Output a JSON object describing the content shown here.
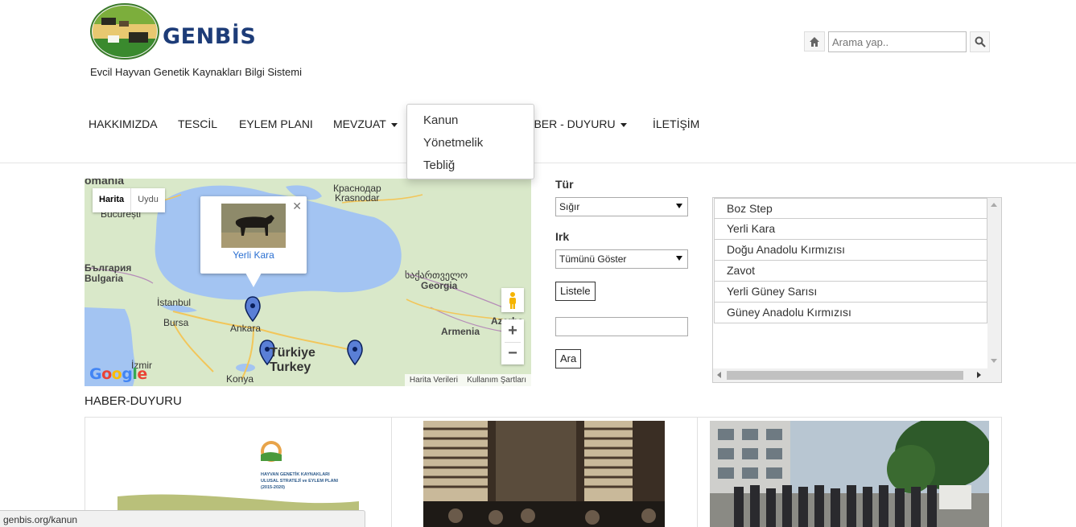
{
  "header": {
    "brand": "GENBİS",
    "tagline": "Evcil Hayvan Genetik Kaynakları Bilgi Sistemi",
    "search": {
      "placeholder": "Arama yap.."
    }
  },
  "nav": {
    "items": [
      {
        "label": "HAKKIMIZDA"
      },
      {
        "label": "TESCİL"
      },
      {
        "label": "EYLEM PLANI"
      },
      {
        "label": "MEVZUAT"
      },
      {
        "label": "HABER - DUYURU"
      },
      {
        "label": "İLETİŞİM"
      }
    ],
    "dropdown": [
      "Kanun",
      "Yönetmelik",
      "Tebliğ"
    ]
  },
  "map": {
    "type_buttons": [
      "Harita",
      "Uydu"
    ],
    "labels": {
      "romania": "omania",
      "bucharest": "București",
      "bulgaria_bg": "България",
      "bulgaria": "Bulgaria",
      "istanbul": "İstanbul",
      "bursa": "Bursa",
      "ankara": "Ankara",
      "izmir": "İzmir",
      "konya": "Konya",
      "turkiye": "Türkiye",
      "turkey": "Turkey",
      "krasnodar_ru": "Краснодар",
      "krasnodar": "Krasnodar",
      "georgia_ka": "საქართველო",
      "georgia": "Georgia",
      "armenia": "Armenia",
      "azerbaijan": "Azerba"
    },
    "popup_label": "Yerli Kara",
    "google": "Google",
    "terms": [
      "Harita Verileri",
      "Kullanım Şartları"
    ]
  },
  "form": {
    "tur_label": "Tür",
    "tur_value": "Sığır",
    "irk_label": "Irk",
    "irk_value": "Tümünü Göster",
    "list_button": "Listele",
    "search_button": "Ara"
  },
  "breeds": [
    "Boz Step",
    "Yerli Kara",
    "Doğu Anadolu Kırmızısı",
    "Zavot",
    "Yerli Güney Sarısı",
    "Güney Anadolu Kırmızısı"
  ],
  "news": {
    "title": "HABER-DUYURU",
    "poster_lines": [
      "HAYVAN GENETİK KAYNAKLARI",
      "ULUSAL STRATEJİ ve EYLEM PLANI",
      "(2015-2020)"
    ]
  },
  "status_bar": "genbis.org/kanun",
  "colors": {
    "brand": "#1d3c78",
    "link": "#2a6fd1",
    "water": "#a3c4f2",
    "land": "#d9e8c9",
    "marker": "#5a7fd6"
  }
}
